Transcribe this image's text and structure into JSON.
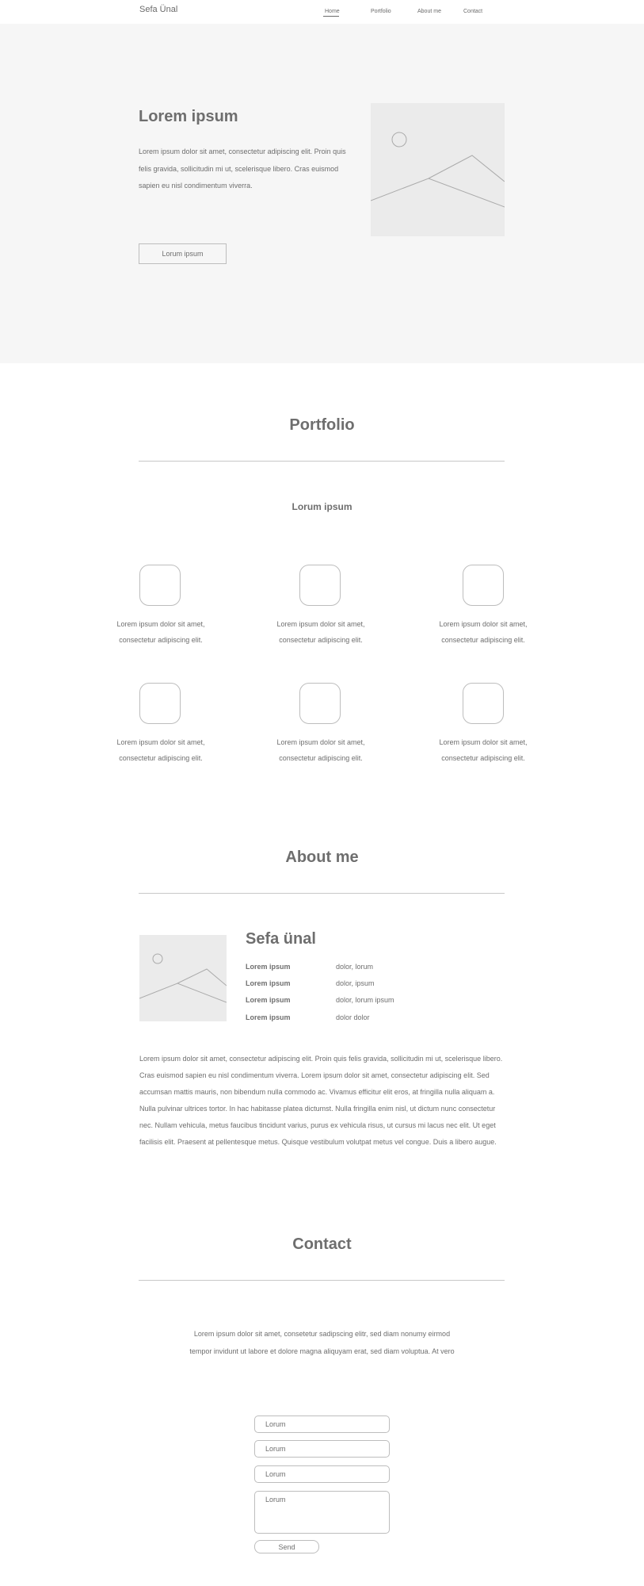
{
  "header": {
    "brand": "Sefa Ünal",
    "nav": [
      "Home",
      "Portfolio",
      "About me",
      "Contact"
    ],
    "active": "Home"
  },
  "hero": {
    "title": "Lorem ipsum",
    "text": "Lorem ipsum dolor sit amet, consectetur adipiscing elit. Proin quis felis gravida, sollicitudin mi ut, scelerisque libero. Cras euismod sapien eu nisl condimentum viverra.",
    "button": "Lorum ipsum",
    "image_icon": "image-placeholder-icon"
  },
  "portfolio": {
    "title": "Portfolio",
    "subtitle": "Lorum ipsum",
    "items": [
      "Lorem ipsum dolor sit amet, consectetur adipiscing elit.",
      "Lorem ipsum dolor sit amet, consectetur adipiscing elit.",
      "Lorem ipsum dolor sit amet, consectetur adipiscing elit.",
      "Lorem ipsum dolor sit amet, consectetur adipiscing elit.",
      "Lorem ipsum dolor sit amet, consectetur adipiscing elit.",
      "Lorem ipsum dolor sit amet, consectetur adipiscing elit."
    ]
  },
  "about": {
    "title": "About me",
    "name": "Sefa ünal",
    "details": [
      {
        "label": "Lorem ipsum",
        "value": "dolor, lorum"
      },
      {
        "label": "Lorem ipsum",
        "value": "dolor, ipsum"
      },
      {
        "label": "Lorem ipsum",
        "value": "dolor, lorum ipsum"
      },
      {
        "label": "Lorem ipsum",
        "value": "dolor dolor"
      }
    ],
    "text": "Lorem ipsum dolor sit amet, consectetur adipiscing elit. Proin quis felis gravida, sollicitudin mi ut, scelerisque libero. Cras euismod sapien eu nisl condimentum viverra. Lorem ipsum dolor sit amet, consectetur adipiscing elit. Sed accumsan mattis mauris, non bibendum nulla commodo ac. Vivamus efficitur elit eros, at fringilla nulla aliquam a. Nulla pulvinar ultrices tortor. In hac habitasse platea dictumst. Nulla fringilla enim nisl, ut dictum nunc consectetur nec. Nullam vehicula, metus faucibus tincidunt varius, purus ex vehicula risus, ut cursus mi lacus nec elit. Ut eget facilisis elit. Praesent at pellentesque metus. Quisque vestibulum volutpat metus vel congue. Duis a libero augue."
  },
  "contact": {
    "title": "Contact",
    "text": "Lorem ipsum dolor sit amet, consetetur sadipscing elitr, sed diam nonumy eirmod tempor invidunt ut labore et dolore magna aliquyam erat, sed diam voluptua. At vero",
    "fields": [
      "Lorum",
      "Lorum",
      "Lorum",
      "Lorum"
    ],
    "send": "Send"
  }
}
